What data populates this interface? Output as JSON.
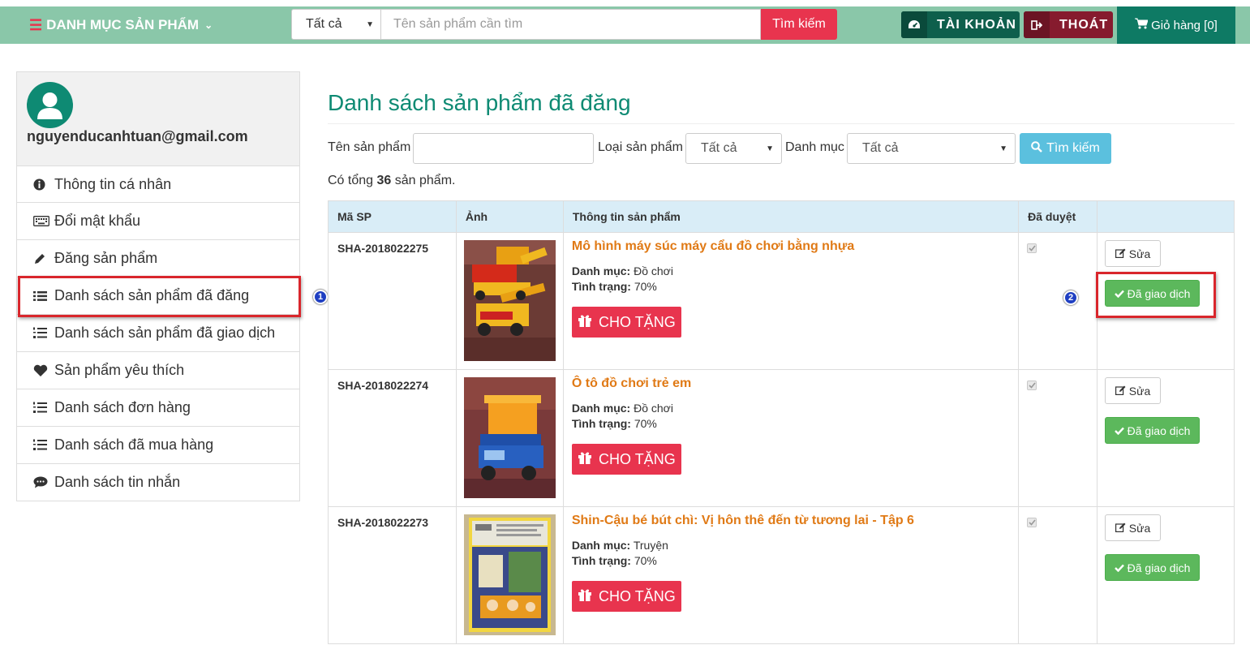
{
  "header": {
    "category_menu_label": "DANH MỤC SẢN PHẨM",
    "search_category": "Tất cả",
    "search_placeholder": "Tên sản phẩm cần tìm",
    "search_button": "Tìm kiếm",
    "account_button": "TÀI KHOẢN",
    "logout_button": "THOÁT",
    "cart_label": "Giỏ hàng [0]"
  },
  "sidebar": {
    "email": "nguyenducanhtuan@gmail.com",
    "items": [
      {
        "label": "Thông tin cá nhân",
        "icon": "info-circle-icon"
      },
      {
        "label": "Đổi mật khẩu",
        "icon": "keyboard-icon"
      },
      {
        "label": "Đăng sản phẩm",
        "icon": "pencil-icon"
      },
      {
        "label": "Danh sách sản phẩm đã đăng",
        "icon": "list-icon"
      },
      {
        "label": "Danh sách sản phẩm đã giao dịch",
        "icon": "ordered-list-icon"
      },
      {
        "label": "Sản phẩm yêu thích",
        "icon": "heart-icon"
      },
      {
        "label": "Danh sách đơn hàng",
        "icon": "ordered-list-icon"
      },
      {
        "label": "Danh sách đã mua hàng",
        "icon": "ordered-list-icon"
      },
      {
        "label": "Danh sách tin nhắn",
        "icon": "comment-icon"
      }
    ]
  },
  "annotations": {
    "badge_1": "1",
    "badge_2": "2",
    "highlight_color": "#d9262c"
  },
  "main": {
    "title": "Danh sách sản phẩm đã đăng",
    "filters": {
      "name_label": "Tên sản phẩm",
      "name_value": "",
      "type_label": "Loại sản phẩm",
      "type_value": "Tất cả",
      "category_label": "Danh mục",
      "category_value": "Tất cả",
      "search_button": "Tìm kiếm"
    },
    "total_prefix": "Có tổng",
    "total_count": "36",
    "total_suffix": "sản phẩm.",
    "table": {
      "headers": [
        "Mã SP",
        "Ảnh",
        "Thông tin sản phẩm",
        "Đã duyệt",
        ""
      ],
      "category_label": "Danh mục:",
      "condition_label": "Tình trạng:",
      "gift_label": "CHO TẶNG",
      "edit_label": "Sửa",
      "done_label": "Đã giao dịch",
      "rows": [
        {
          "code": "SHA-2018022275",
          "name": "Mô hình máy súc máy cẩu đồ chơi bằng nhựa",
          "category": "Đồ chơi",
          "condition": "70%",
          "approved": true
        },
        {
          "code": "SHA-2018022274",
          "name": "Ô tô đồ chơi trẻ em",
          "category": "Đồ chơi",
          "condition": "70%",
          "approved": true
        },
        {
          "code": "SHA-2018022273",
          "name": "Shin-Cậu bé bút chì: Vị hôn thê đến từ tương lai - Tập 6",
          "category": "Truyện",
          "condition": "70%",
          "approved": true
        }
      ]
    }
  },
  "colors": {
    "brand_green": "#8ac7a9",
    "title_green": "#0e8a73",
    "accent_red": "#e8344e",
    "name_orange": "#e07a16",
    "success_green": "#5cb85c",
    "info_blue": "#5bc0de"
  }
}
